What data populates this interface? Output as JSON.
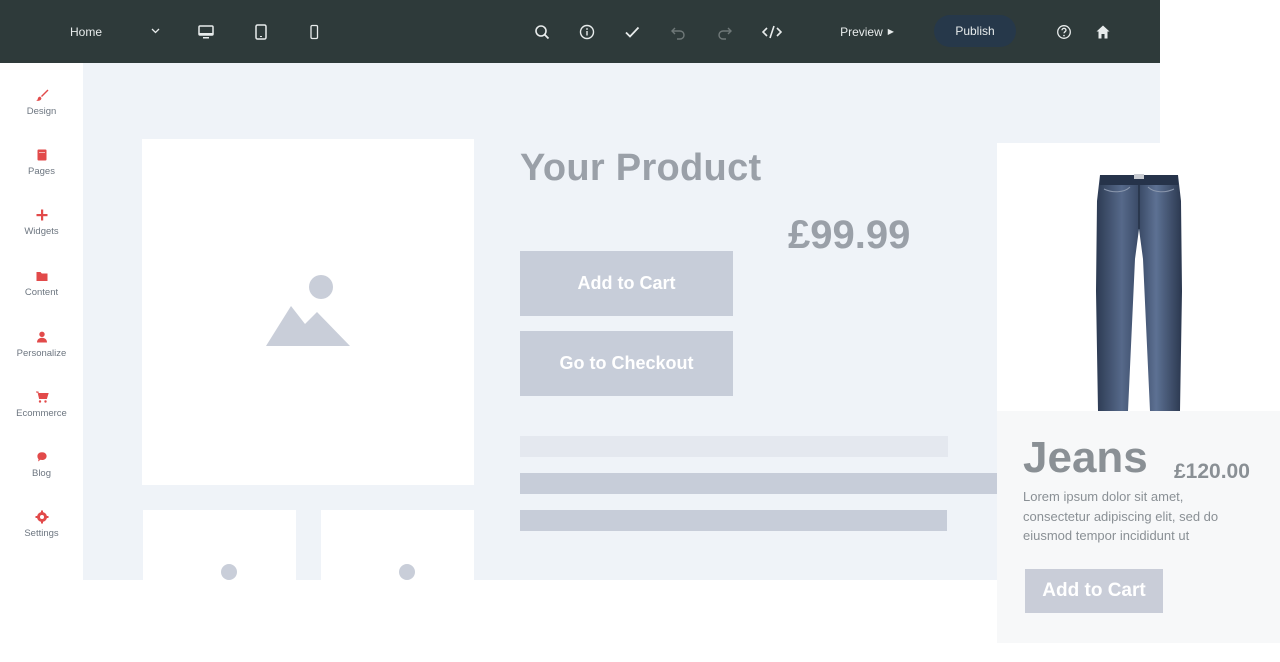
{
  "topbar": {
    "page_select": "Home",
    "preview_label": "Preview",
    "publish_label": "Publish"
  },
  "sidebar": {
    "accent_color": "#e24a4a",
    "items": [
      {
        "label": "Design",
        "icon": "brush-icon"
      },
      {
        "label": "Pages",
        "icon": "pages-icon"
      },
      {
        "label": "Widgets",
        "icon": "plus-icon"
      },
      {
        "label": "Content",
        "icon": "folder-icon"
      },
      {
        "label": "Personalize",
        "icon": "person-icon"
      },
      {
        "label": "Ecommerce",
        "icon": "cart-icon"
      },
      {
        "label": "Blog",
        "icon": "chat-bubble-icon"
      },
      {
        "label": "Settings",
        "icon": "gear-icon"
      }
    ]
  },
  "canvas": {
    "product_title": "Your Product",
    "product_price": "£99.99",
    "add_to_cart_label": "Add to Cart",
    "checkout_label": "Go to Checkout"
  },
  "card": {
    "name": "Jeans",
    "price": "£120.00",
    "description": "Lorem ipsum dolor sit amet, consectetur adipiscing elit, sed do eiusmod tempor incididunt ut",
    "button_label": "Add to Cart"
  }
}
